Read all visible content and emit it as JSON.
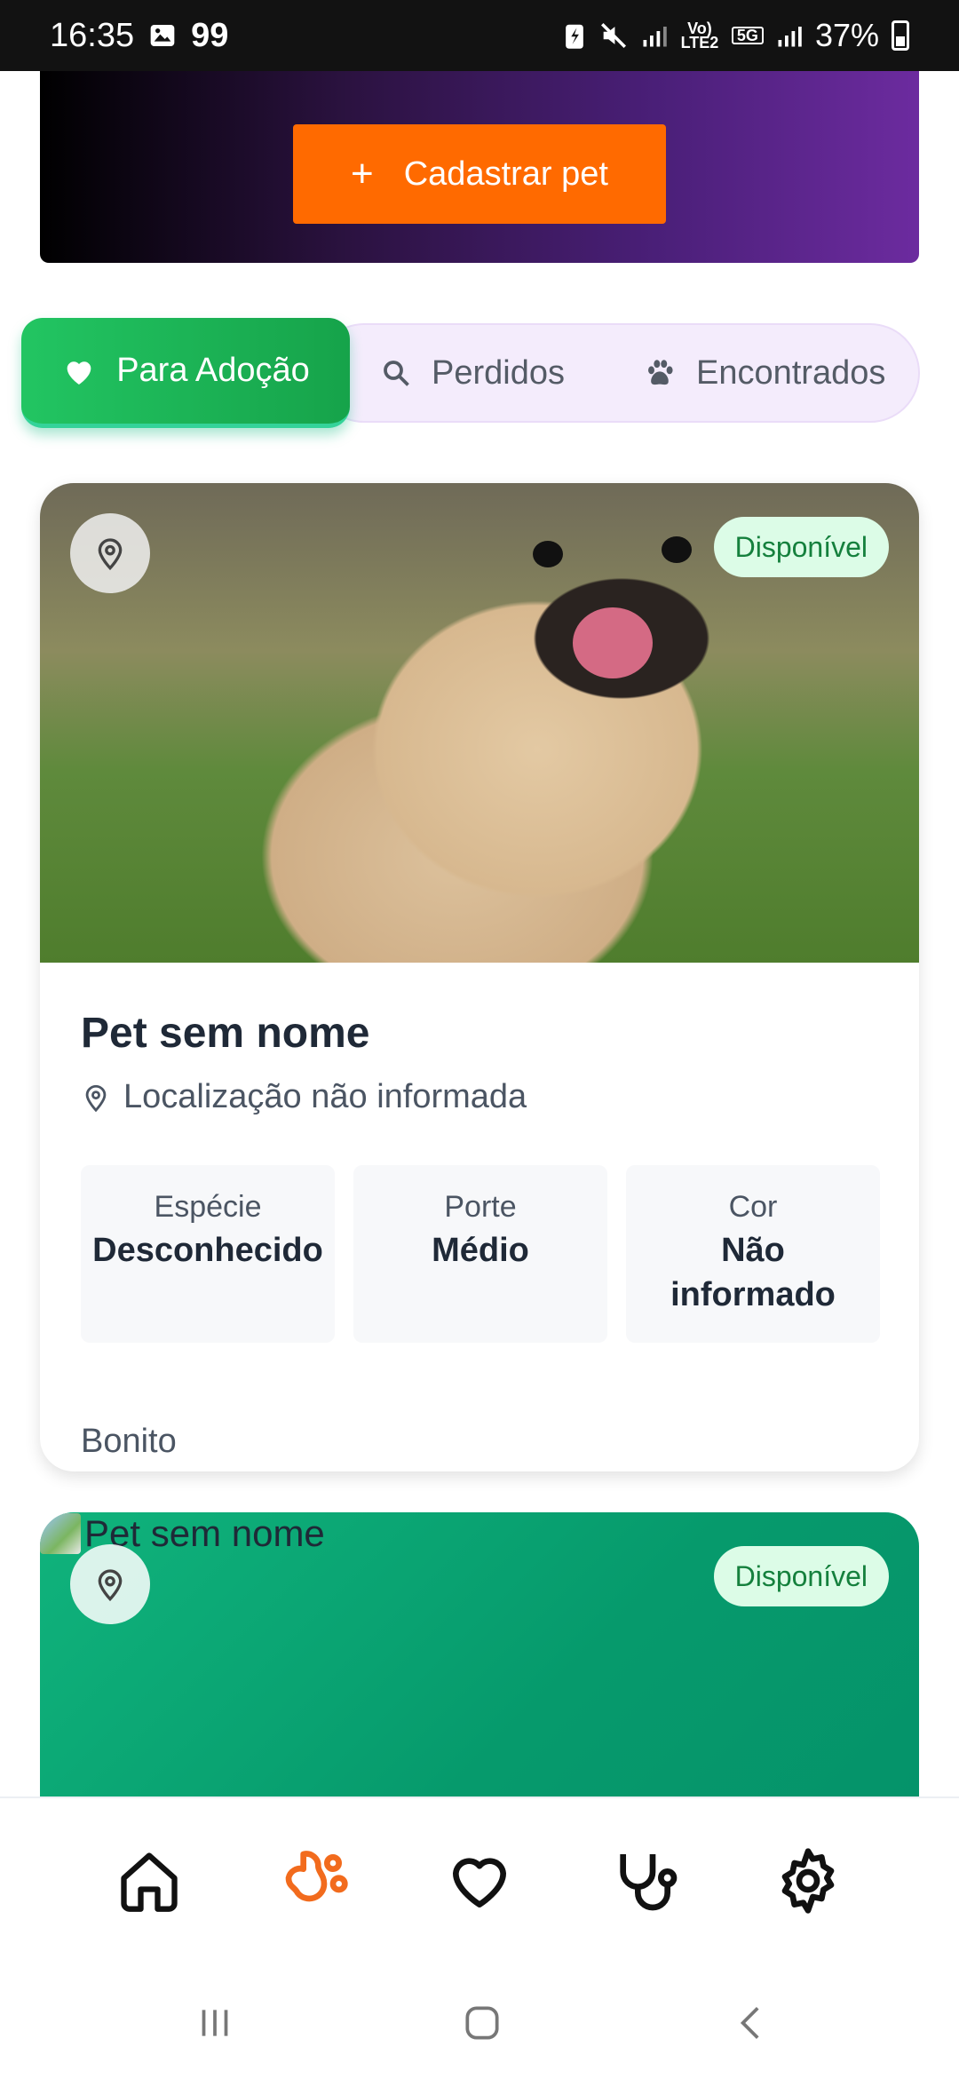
{
  "status_bar": {
    "time": "16:35",
    "notification_count": "99",
    "network_lte": "Vo) LTE2",
    "network_5g": "5G",
    "battery": "37%"
  },
  "hero": {
    "cta_label": "Cadastrar pet",
    "cta_icon": "plus-icon",
    "background_colors": [
      "#000000",
      "#6c2b9f"
    ]
  },
  "tabs": [
    {
      "label": "Para Adoção",
      "icon": "heart-icon",
      "active": true
    },
    {
      "label": "Perdidos",
      "icon": "search-icon",
      "active": false
    },
    {
      "label": "Encontrados",
      "icon": "paw-icon",
      "active": false
    }
  ],
  "pets": [
    {
      "name": "Pet sem nome",
      "status": "Disponível",
      "location": "Localização não informada",
      "attributes": [
        {
          "label": "Espécie",
          "value": "Desconhecido"
        },
        {
          "label": "Porte",
          "value": "Médio"
        },
        {
          "label": "Cor",
          "value": "Não informado"
        }
      ],
      "description": "Bonito"
    },
    {
      "name": "Pet sem nome",
      "status": "Disponível",
      "image_alt": "Pet sem nome"
    }
  ],
  "bottom_nav": [
    {
      "icon": "home-icon",
      "active": false
    },
    {
      "icon": "pets-icon",
      "active": true
    },
    {
      "icon": "heart-icon",
      "active": false
    },
    {
      "icon": "stethoscope-icon",
      "active": false
    },
    {
      "icon": "gear-icon",
      "active": false
    }
  ],
  "colors": {
    "accent": "#ff6a00",
    "tab_active": "#22c562",
    "status_bg": "#dcfce7",
    "status_text": "#15803d",
    "card2_bg": "#10b37c"
  }
}
